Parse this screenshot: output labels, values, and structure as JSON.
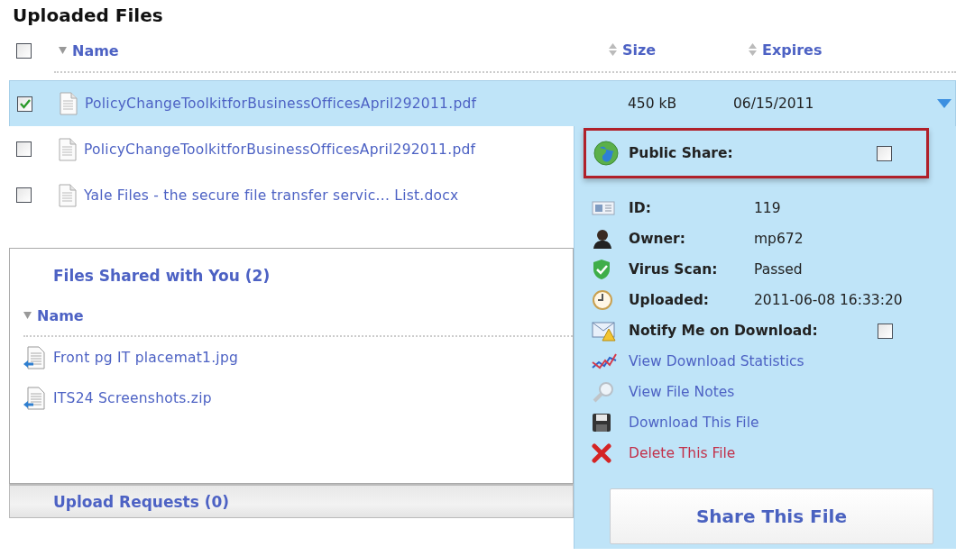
{
  "title": "Uploaded Files",
  "header_checkbox": {
    "checked": false
  },
  "columns": [
    {
      "label": "Name",
      "sorted": true
    },
    {
      "label": "Size",
      "sorted": false
    },
    {
      "label": "Expires",
      "sorted": false
    }
  ],
  "files": [
    {
      "name": "PolicyChangeToolkitforBusinessOfficesApril292011.pdf",
      "size": "450 kB",
      "expires": "06/15/2011",
      "checked": true,
      "selected": true
    },
    {
      "name": "PolicyChangeToolkitforBusinessOfficesApril292011.pdf",
      "checked": false,
      "selected": false
    },
    {
      "name": "Yale Files - the secure file transfer servic... List.docx",
      "checked": false,
      "selected": false
    }
  ],
  "details": {
    "public_share": {
      "label": "Public Share:",
      "checked": false
    },
    "items": [
      {
        "kind": "field",
        "label": "ID:",
        "value": "119"
      },
      {
        "kind": "field",
        "label": "Owner:",
        "value": "mp672"
      },
      {
        "kind": "field",
        "label": "Virus Scan:",
        "value": "Passed"
      },
      {
        "kind": "field",
        "label": "Uploaded:",
        "value": "2011-06-08 16:33:20"
      },
      {
        "kind": "toggle",
        "label": "Notify Me on Download:",
        "checked": false
      },
      {
        "kind": "link",
        "label": "View Download Statistics"
      },
      {
        "kind": "link",
        "label": "View File Notes"
      },
      {
        "kind": "link",
        "label": "Download This File"
      },
      {
        "kind": "danger",
        "label": "Delete This File"
      }
    ],
    "share_button": "Share This File"
  },
  "shared": {
    "title": "Files Shared with You (2)",
    "column": {
      "label": "Name",
      "sorted": true
    },
    "files": [
      {
        "name": "Front pg IT placemat1.jpg"
      },
      {
        "name": "ITS24 Screenshots.zip"
      }
    ]
  },
  "upload_requests": {
    "title": "Upload Requests (0)"
  }
}
